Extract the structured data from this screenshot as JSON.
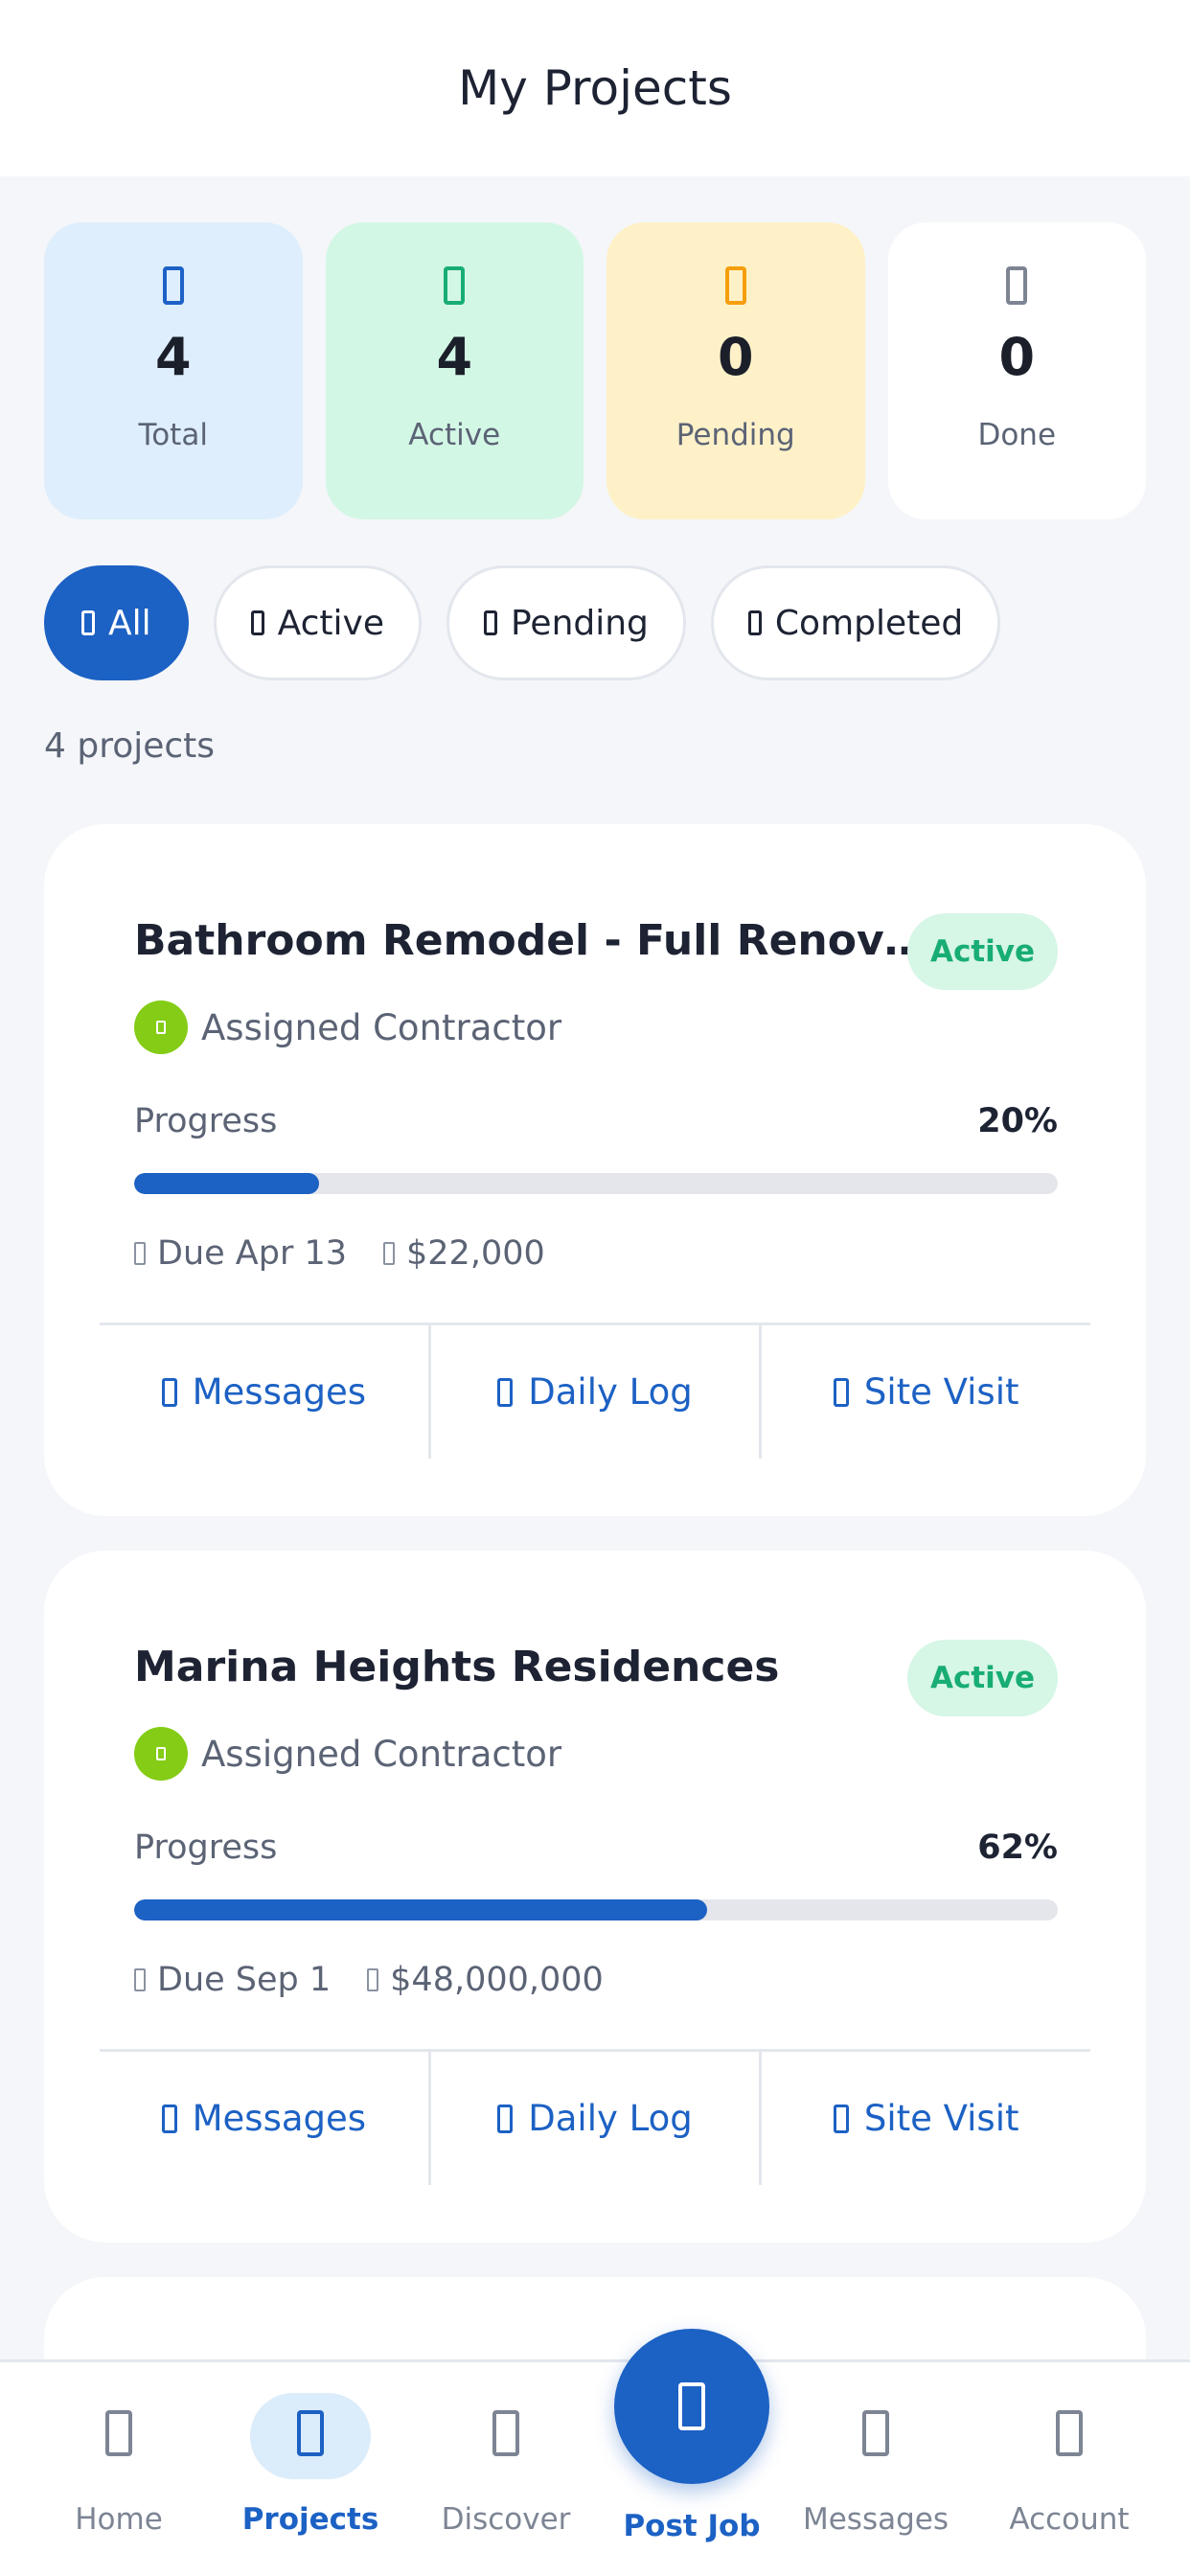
{
  "header": {
    "title": "My Projects"
  },
  "stats": [
    {
      "key": "total",
      "icon": "folder-icon",
      "value": "4",
      "label": "Total"
    },
    {
      "key": "active",
      "icon": "hammer-icon",
      "value": "4",
      "label": "Active"
    },
    {
      "key": "pending",
      "icon": "clock-icon",
      "value": "0",
      "label": "Pending"
    },
    {
      "key": "done",
      "icon": "check-icon",
      "value": "0",
      "label": "Done"
    }
  ],
  "filters": [
    {
      "label": "All",
      "icon": "grid-icon",
      "selected": true
    },
    {
      "label": "Active",
      "icon": "hammer-icon",
      "selected": false
    },
    {
      "label": "Pending",
      "icon": "clock-icon",
      "selected": false
    },
    {
      "label": "Completed",
      "icon": "check-icon",
      "selected": false
    }
  ],
  "count_text": "4 projects",
  "projects": [
    {
      "title": "Bathroom Remodel - Full Renovation",
      "status": "Active",
      "contractor": "Assigned Contractor",
      "progress_label": "Progress",
      "progress_pct": 20,
      "progress_text": "20%",
      "due": "Due Apr 13",
      "budget": "$22,000",
      "actions": [
        "Messages",
        "Daily Log",
        "Site Visit"
      ]
    },
    {
      "title": "Marina Heights Residences",
      "status": "Active",
      "contractor": "Assigned Contractor",
      "progress_label": "Progress",
      "progress_pct": 62,
      "progress_text": "62%",
      "due": "Due Sep 1",
      "budget": "$48,000,000",
      "actions": [
        "Messages",
        "Daily Log",
        "Site Visit"
      ]
    }
  ],
  "nav": {
    "items": [
      {
        "label": "Home",
        "icon": "home-icon",
        "selected": false
      },
      {
        "label": "Projects",
        "icon": "folder-icon",
        "selected": true
      },
      {
        "label": "Discover",
        "icon": "compass-icon",
        "selected": false
      },
      {
        "label": "Messages",
        "icon": "chat-icon",
        "selected": false
      },
      {
        "label": "Account",
        "icon": "user-icon",
        "selected": false
      }
    ],
    "fab": {
      "label": "Post Job",
      "icon": "plus-icon"
    }
  },
  "colors": {
    "accent": "#1c61c4",
    "active_green": "#18ad72",
    "pending_amber": "#f59e0b"
  }
}
